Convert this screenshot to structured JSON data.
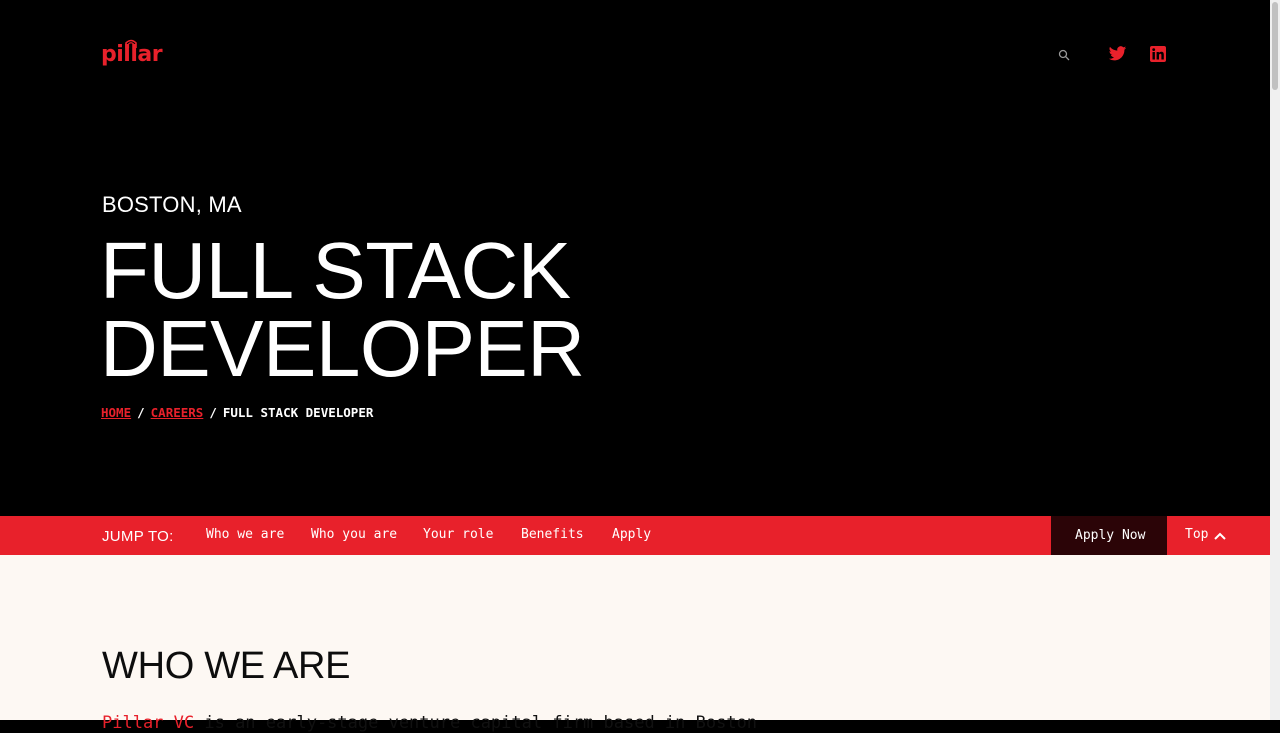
{
  "header": {
    "logo_text": "pillar",
    "location": "BOSTON, MA",
    "title_line1": "FULL STACK",
    "title_line2": "DEVELOPER"
  },
  "breadcrumb": {
    "home": "HOME",
    "careers": "CAREERS",
    "current": "FULL STACK DEVELOPER",
    "separator": "/"
  },
  "jump_bar": {
    "label": "JUMP TO:",
    "links": [
      "Who we are",
      "Who you are",
      "Your role",
      "Benefits",
      "Apply"
    ],
    "apply_now": "Apply Now",
    "top": "Top"
  },
  "section": {
    "title": "WHO WE ARE",
    "intro_brand": "Pillar VC",
    "intro_rest": " is an early-stage venture capital firm based in Boston"
  },
  "icons": {
    "social": [
      "search-icon",
      "twitter-icon",
      "linkedin-icon"
    ],
    "top": "chevron-up-icon"
  },
  "colors": {
    "brand_red": "#e8212b",
    "dark_bg": "#000000",
    "apply_bg": "#2b0407",
    "content_bg": "#fdf8f3"
  }
}
